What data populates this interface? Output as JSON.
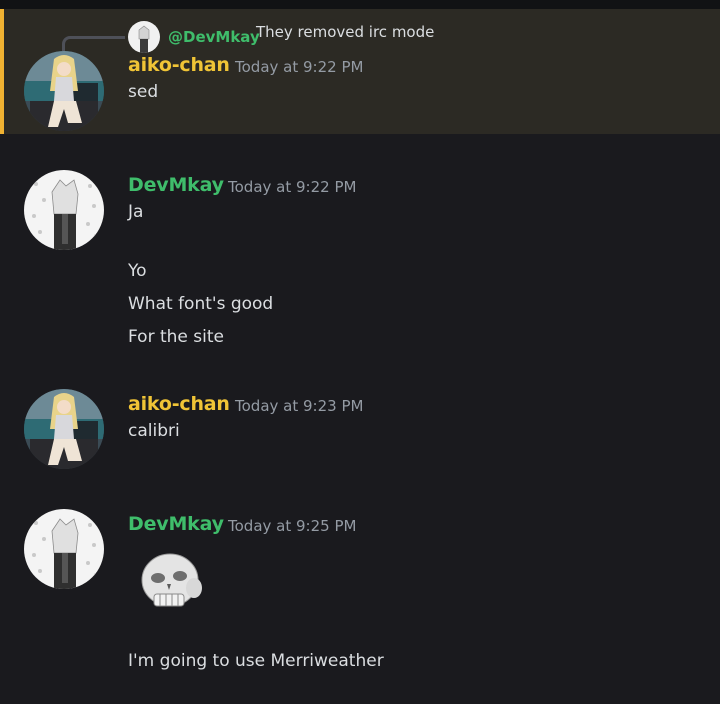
{
  "reply": {
    "author": "@DevMkay",
    "text": "They removed irc mode"
  },
  "messages": [
    {
      "author": "aiko-chan",
      "timestamp": "Today at 9:22 PM",
      "lines": [
        "sed"
      ]
    },
    {
      "author": "DevMkay",
      "timestamp": "Today at 9:22 PM",
      "lines": [
        "Ja",
        "Yo",
        "What font's good",
        "For the site"
      ]
    },
    {
      "author": "aiko-chan",
      "timestamp": "Today at 9:23 PM",
      "lines": [
        "calibri"
      ]
    },
    {
      "author": "DevMkay",
      "timestamp": "Today at 9:25 PM",
      "lines": [
        "I'm going to use Merriweather"
      ]
    }
  ],
  "colors": {
    "background": "#1a1a1e",
    "highlight": "#2c2a24",
    "mention_bar": "#f0b232",
    "aiko_name": "#f0c436",
    "devmkay_name": "#3fbd6b",
    "timestamp": "#949ba4"
  },
  "icons": {
    "sticker": "skull-sticker-icon"
  }
}
